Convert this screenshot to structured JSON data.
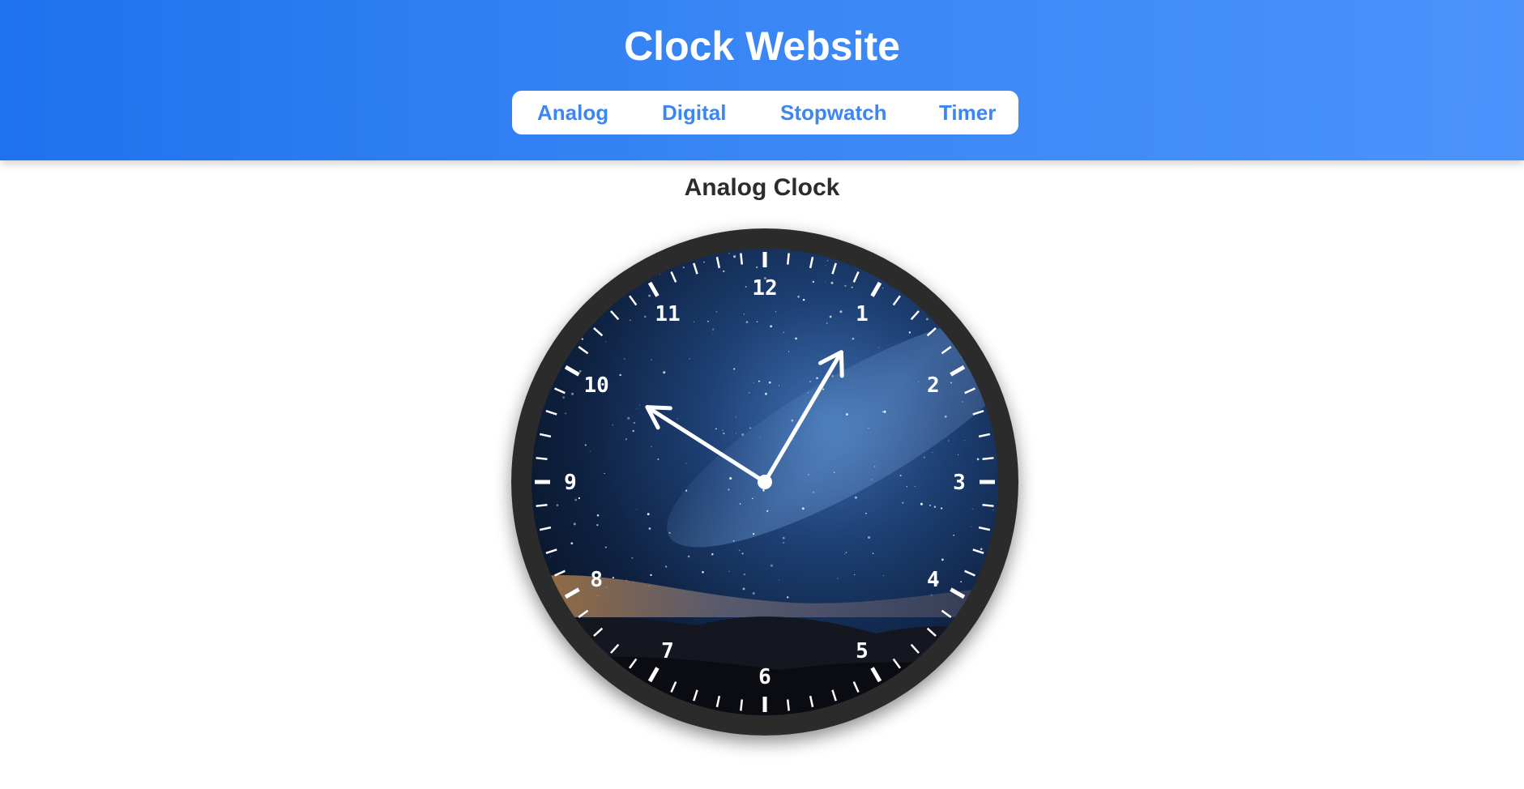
{
  "header": {
    "title": "Clock Website",
    "nav": [
      {
        "label": "Analog"
      },
      {
        "label": "Digital"
      },
      {
        "label": "Stopwatch"
      },
      {
        "label": "Timer"
      }
    ]
  },
  "main": {
    "section_title": "Analog Clock"
  },
  "clock": {
    "numerals": [
      "12",
      "1",
      "2",
      "3",
      "4",
      "5",
      "6",
      "7",
      "8",
      "9",
      "10",
      "11"
    ],
    "time": {
      "hour": 10,
      "minute": 5,
      "second": 5
    },
    "frame_color": "#2b2b2b",
    "hand_color": "#ffffff",
    "face_background": "starry-night-sky"
  },
  "colors": {
    "header_gradient_start": "#1f72ee",
    "header_gradient_end": "#4b93fb",
    "nav_text": "#3a86f5"
  }
}
